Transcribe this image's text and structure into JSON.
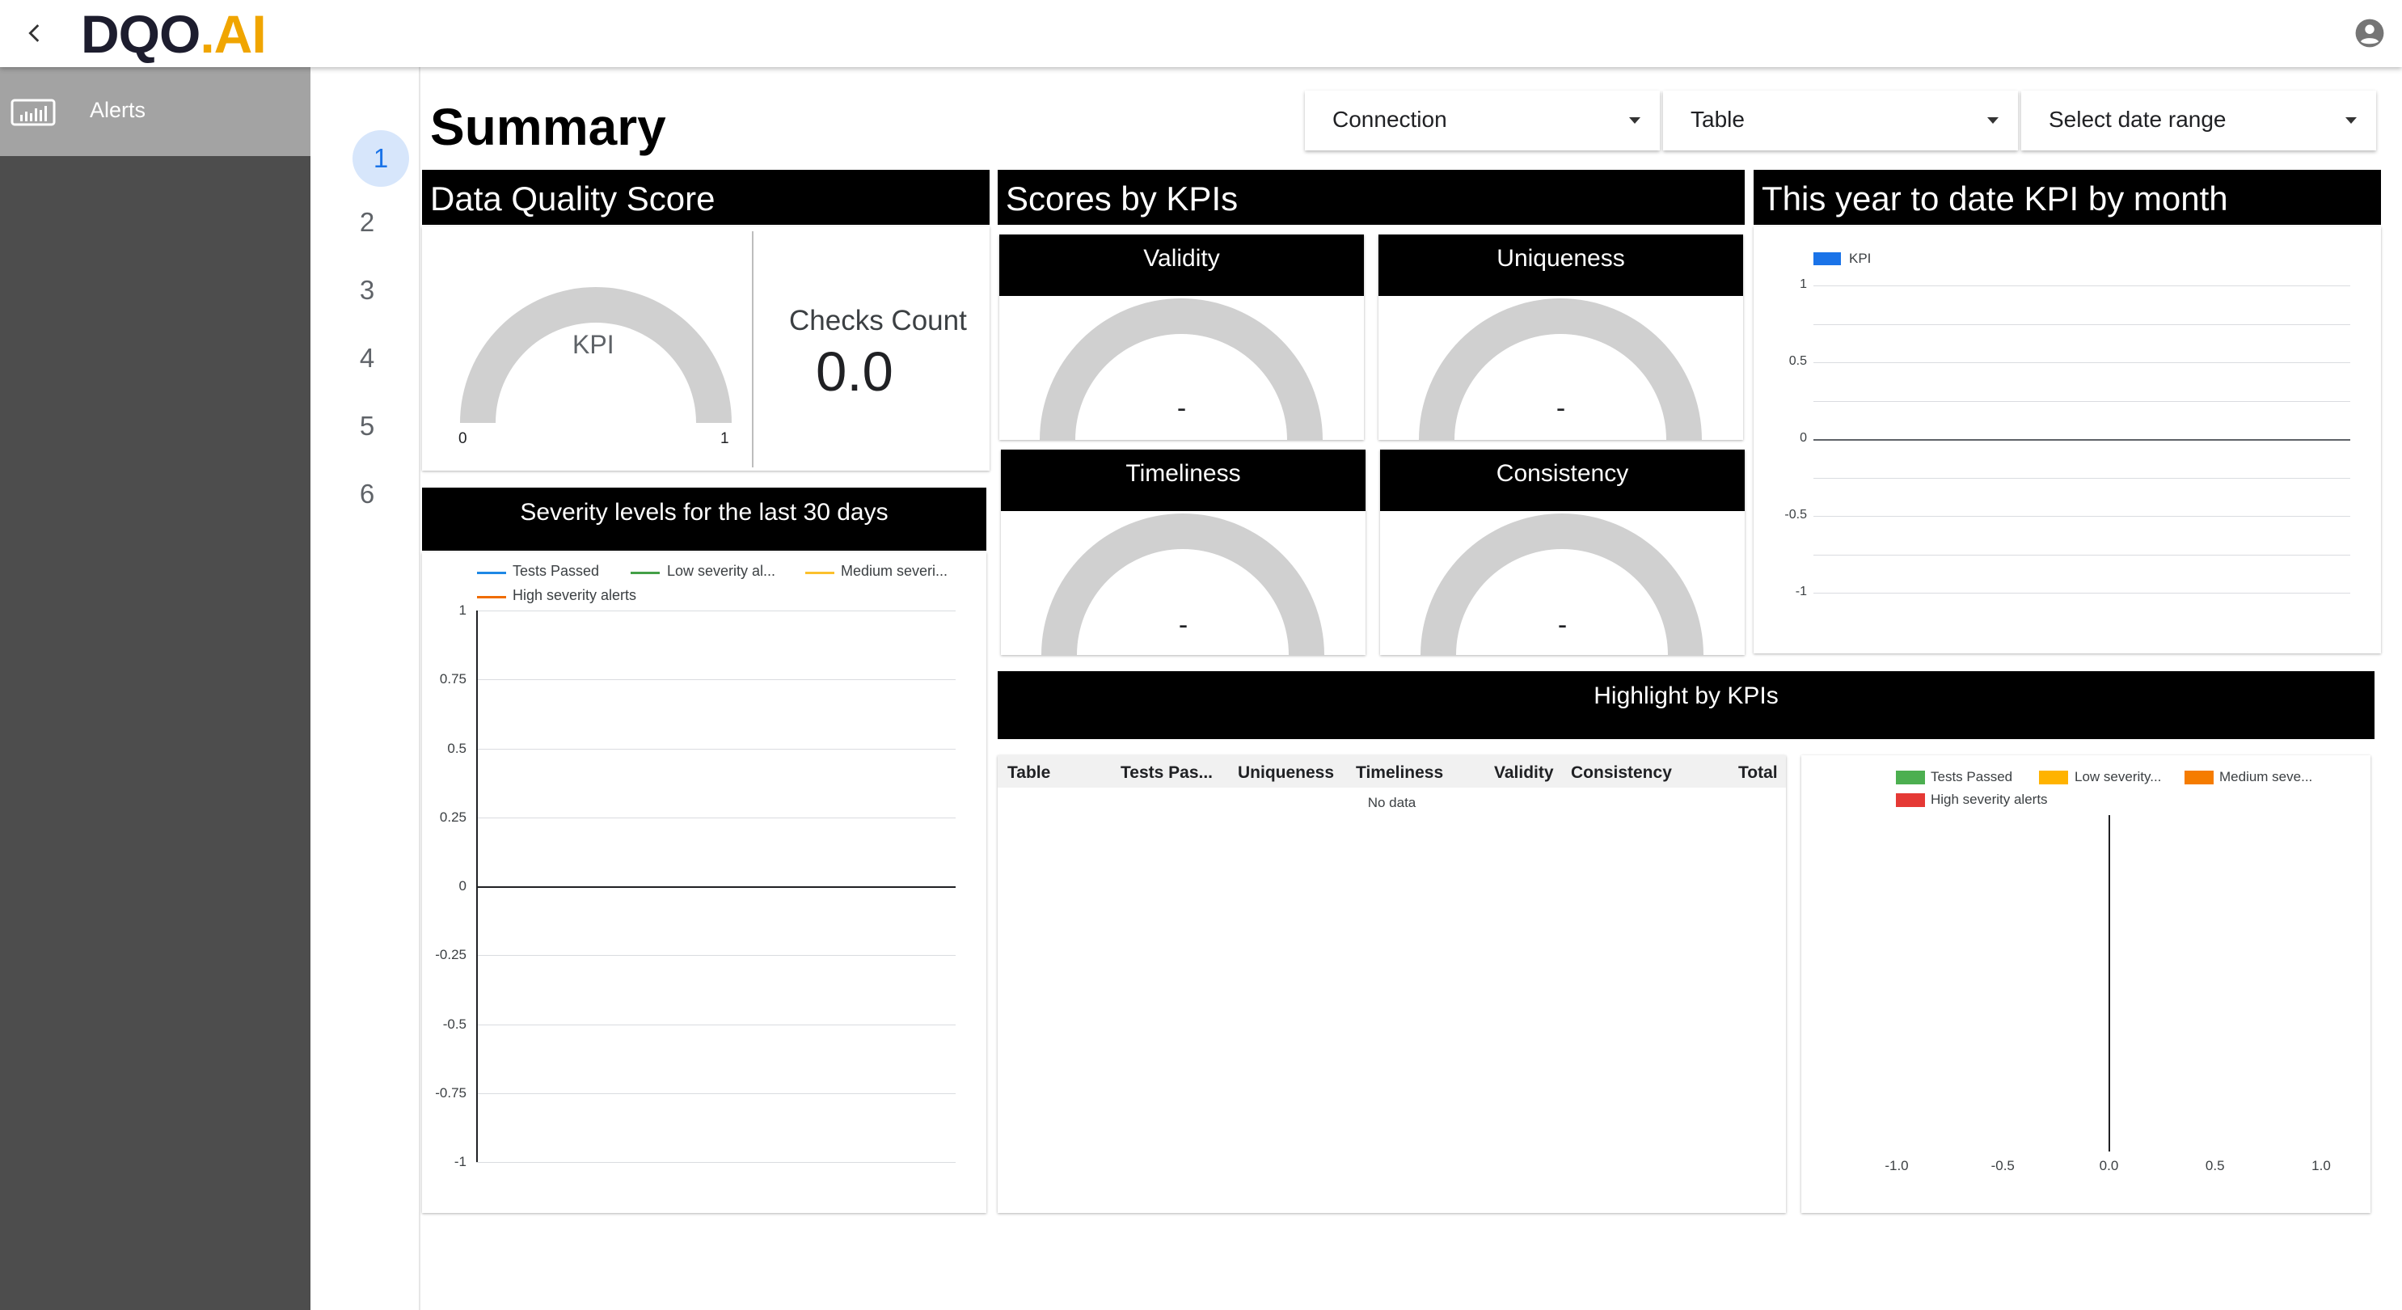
{
  "header": {
    "logo_dq": "DQO",
    "logo_ai": ".AI",
    "back_icon": "chevron-left-icon",
    "user_icon": "account-circle-icon"
  },
  "sidebar": {
    "items": [
      {
        "label": "Alerts",
        "icon": "dashboard-icon"
      }
    ]
  },
  "page_nav": [
    "1",
    "2",
    "3",
    "4",
    "5",
    "6"
  ],
  "page_nav_active": "1",
  "main": {
    "title": "Summary",
    "filters": {
      "connection": "Connection",
      "table": "Table",
      "date_range": "Select date range"
    }
  },
  "dq_score": {
    "title": "Data Quality Score",
    "gauge_label": "KPI",
    "gauge_min": "0",
    "gauge_max": "1",
    "checks_label": "Checks Count",
    "checks_value": "0.0"
  },
  "severity_chart": {
    "title": "Severity levels for the last 30 days"
  },
  "kpis": {
    "title": "Scores by KPIs",
    "cards": [
      {
        "name": "Validity",
        "value": "-"
      },
      {
        "name": "Uniqueness",
        "value": "-"
      },
      {
        "name": "Timeliness",
        "value": "-"
      },
      {
        "name": "Consistency",
        "value": "-"
      }
    ]
  },
  "monthly": {
    "title": "This year to date KPI by month"
  },
  "highlight": {
    "title": "Highlight by KPIs",
    "table_headers": [
      "Table",
      "Tests Pas...",
      "Uniqueness",
      "Timeliness",
      "Validity",
      "Consistency",
      "Total"
    ],
    "empty_text": "No data"
  },
  "chart_data": [
    {
      "type": "line",
      "title": "Severity levels for the last 30 days",
      "series": [
        {
          "name": "Tests Passed",
          "label": "Tests Passed",
          "color": "#1e88e5",
          "values": []
        },
        {
          "name": "Low severity alerts",
          "label": "Low severity al...",
          "color": "#43a047",
          "values": []
        },
        {
          "name": "Medium severity alerts",
          "label": "Medium severi...",
          "color": "#fbc02d",
          "values": []
        },
        {
          "name": "High severity alerts",
          "label": "High severity alerts",
          "color": "#ef6c00",
          "values": []
        }
      ],
      "yticks": [
        "1",
        "0.75",
        "0.5",
        "0.25",
        "0",
        "-0.25",
        "-0.5",
        "-0.75",
        "-1"
      ],
      "ylim": [
        -1,
        1
      ],
      "legend": "top",
      "grid": true
    },
    {
      "type": "bar",
      "title": "This year to date KPI by month",
      "series": [
        {
          "name": "KPI",
          "color": "#1a73e8",
          "values": []
        }
      ],
      "yticks": [
        "1",
        "0.5",
        "0",
        "-0.5",
        "-1"
      ],
      "ylim": [
        -1,
        1
      ],
      "legend": "top-left",
      "grid": true
    },
    {
      "type": "bar",
      "title": "",
      "series": [
        {
          "name": "Tests Passed",
          "label": "Tests Passed",
          "color": "#4caf50",
          "values": []
        },
        {
          "name": "Low severity alerts",
          "label": "Low severity...",
          "color": "#ffb300",
          "values": []
        },
        {
          "name": "Medium severity alerts",
          "label": "Medium seve...",
          "color": "#f57c00",
          "values": []
        },
        {
          "name": "High severity alerts",
          "label": "High severity alerts",
          "color": "#e53935",
          "values": []
        }
      ],
      "xticks": [
        "-1.0",
        "-0.5",
        "0.0",
        "0.5",
        "1.0"
      ],
      "xlim": [
        -1,
        1
      ],
      "legend": "top",
      "grid": false
    }
  ]
}
